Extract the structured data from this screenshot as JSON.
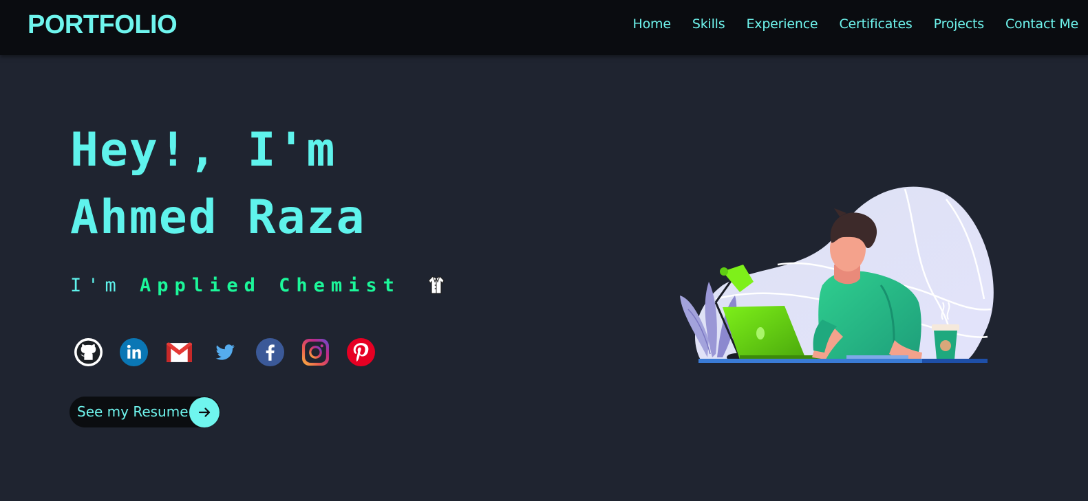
{
  "header": {
    "logo": "PORTFOLIO",
    "nav": [
      "Home",
      "Skills",
      "Experience",
      "Certificates",
      "Projects",
      "Contact Me"
    ]
  },
  "hero": {
    "greeting": "Hey!, I'm",
    "name": "Ahmed Raza",
    "role_prefix": "I'm",
    "role": "Applied Chemist",
    "role_icon": "lab-coat-icon",
    "resume_label": "See my Resume"
  },
  "socials": [
    "github-icon",
    "linkedin-icon",
    "gmail-icon",
    "twitter-icon",
    "facebook-icon",
    "instagram-icon",
    "pinterest-icon"
  ],
  "colors": {
    "accent": "#6ff5ee",
    "role_green": "#1cf79a",
    "background": "#1f2430",
    "navbar": "#0a0c10"
  }
}
